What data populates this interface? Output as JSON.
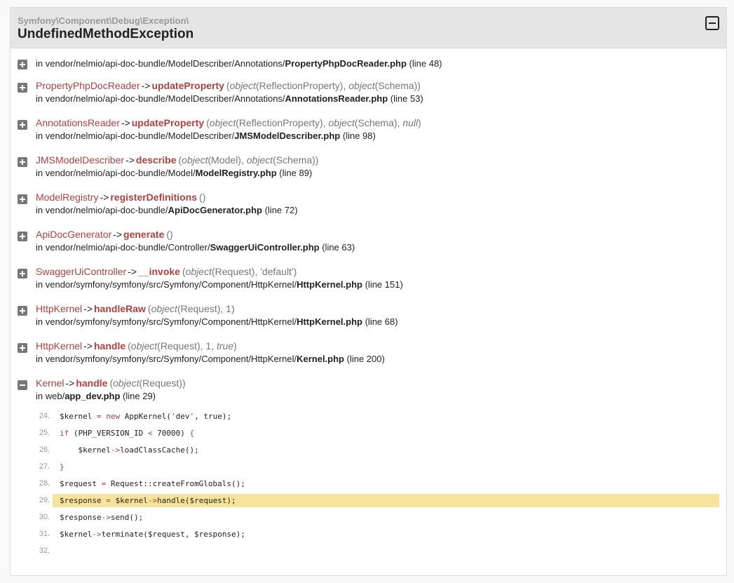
{
  "header": {
    "namespace": "Symfony\\Component\\Debug\\Exception\\",
    "title": "UndefinedMethodException"
  },
  "trace": [
    {
      "class": "",
      "arrow": "",
      "method": "",
      "args": "",
      "prefix": "in vendor/nelmio/api-doc-bundle/ModelDescriber/Annotations/",
      "file": "PropertyPhpDocReader.php",
      "line": "(line 48)",
      "expanded": false
    },
    {
      "class": "PropertyPhpDocReader",
      "arrow": "->",
      "method": "updateProperty",
      "args": "(<i>object</i>(ReflectionProperty), <i>object</i>(Schema))",
      "prefix": "in vendor/nelmio/api-doc-bundle/ModelDescriber/Annotations/",
      "file": "AnnotationsReader.php",
      "line": "(line 53)",
      "expanded": false
    },
    {
      "class": "AnnotationsReader",
      "arrow": "->",
      "method": "updateProperty",
      "args": "(<i>object</i>(ReflectionProperty), <i>object</i>(Schema), <i>null</i>)",
      "prefix": "in vendor/nelmio/api-doc-bundle/ModelDescriber/",
      "file": "JMSModelDescriber.php",
      "line": "(line 98)",
      "expanded": false
    },
    {
      "class": "JMSModelDescriber",
      "arrow": "->",
      "method": "describe",
      "args": "(<i>object</i>(Model), <i>object</i>(Schema))",
      "prefix": "in vendor/nelmio/api-doc-bundle/Model/",
      "file": "ModelRegistry.php",
      "line": "(line 89)",
      "expanded": false
    },
    {
      "class": "ModelRegistry",
      "arrow": "->",
      "method": "registerDefinitions",
      "args": "()",
      "prefix": "in vendor/nelmio/api-doc-bundle/",
      "file": "ApiDocGenerator.php",
      "line": "(line 72)",
      "expanded": false
    },
    {
      "class": "ApiDocGenerator",
      "arrow": "->",
      "method": "generate",
      "args": "()",
      "prefix": "in vendor/nelmio/api-doc-bundle/Controller/",
      "file": "SwaggerUiController.php",
      "line": "(line 63)",
      "expanded": false
    },
    {
      "class": "SwaggerUiController",
      "arrow": "->",
      "method": "__invoke",
      "args": "(<i>object</i>(Request), 'default')",
      "prefix": "in vendor/symfony/symfony/src/Symfony/Component/HttpKernel/",
      "file": "HttpKernel.php",
      "line": "(line 151)",
      "expanded": false
    },
    {
      "class": "HttpKernel",
      "arrow": "->",
      "method": "handleRaw",
      "args": "(<i>object</i>(Request), 1)",
      "prefix": "in vendor/symfony/symfony/src/Symfony/Component/HttpKernel/",
      "file": "HttpKernel.php",
      "line": "(line 68)",
      "expanded": false
    },
    {
      "class": "HttpKernel",
      "arrow": "->",
      "method": "handle",
      "args": "(<i>object</i>(Request), 1, <i>true</i>)",
      "prefix": "in vendor/symfony/symfony/src/Symfony/Component/HttpKernel/",
      "file": "Kernel.php",
      "line": "(line 200)",
      "expanded": false
    },
    {
      "class": "Kernel",
      "arrow": "->",
      "method": "handle",
      "args": "(<i>object</i>(Request))",
      "prefix": "in web/",
      "file": "app_dev.php",
      "line": "(line 29)",
      "expanded": true
    }
  ],
  "code": [
    {
      "n": "24.",
      "src": "$kernel <k>=</k> <k>new</k> AppKernel(<k>'</k>dev<k>'</k>, true);",
      "hl": false
    },
    {
      "n": "25.",
      "src": "<k>if</k> (PHP_VERSION_ID <k>&lt;</k> 70000) <k>{</k>",
      "hl": false
    },
    {
      "n": "26.",
      "src": "    $kernel<k>-&gt;</k>loadClassCache();",
      "hl": false
    },
    {
      "n": "27.",
      "src": "<k>}</k>",
      "hl": false
    },
    {
      "n": "28.",
      "src": "$request <k>=</k> Request::createFromGlobals();",
      "hl": false
    },
    {
      "n": "29.",
      "src": "$response <k>=</k> $kernel<k>-&gt;</k>handle($request);",
      "hl": true
    },
    {
      "n": "30.",
      "src": "$response<k>-&gt;</k>send();",
      "hl": false
    },
    {
      "n": "31.",
      "src": "$kernel<k>-&gt;</k>terminate($request, $response);",
      "hl": false
    },
    {
      "n": "32.",
      "src": "",
      "hl": false
    }
  ],
  "colors": {
    "accent": "#b0413e",
    "highlight": "#f7e39c"
  },
  "icons": {
    "collapse_all": "minus-square-icon",
    "expand": "plus-icon",
    "collapse": "minus-icon"
  }
}
